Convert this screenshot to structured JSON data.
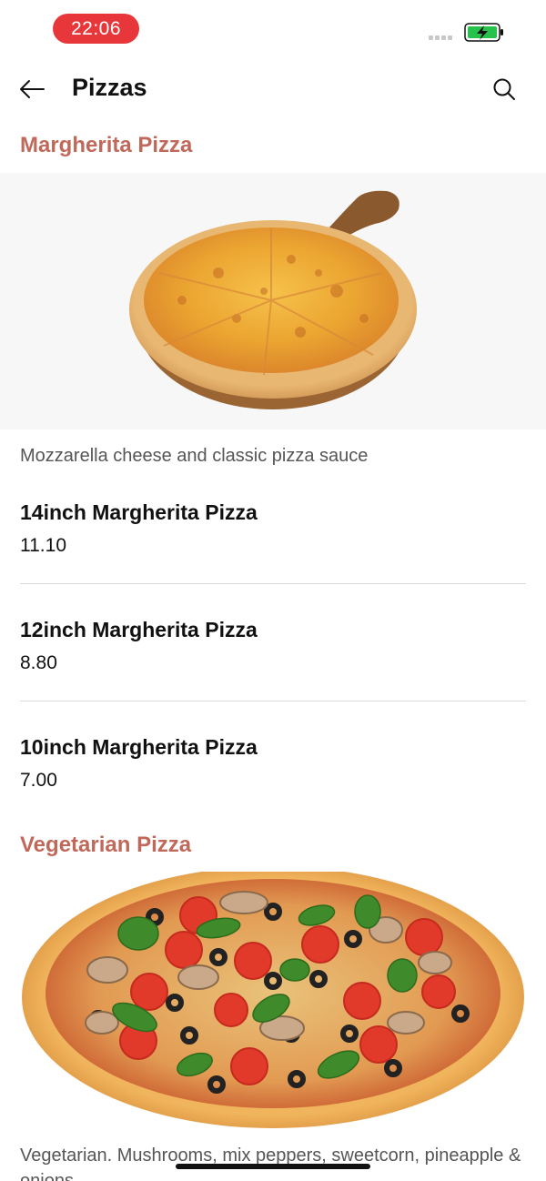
{
  "status_bar": {
    "time": "22:06",
    "battery_color": "#27c24c"
  },
  "nav": {
    "title": "Pizzas",
    "back_icon": "arrow-left-icon",
    "search_icon": "search-icon"
  },
  "categories": [
    {
      "title": "Margherita Pizza",
      "image": "margherita-pizza-photo",
      "description": "Mozzarella cheese and classic pizza sauce",
      "items": [
        {
          "name": "14inch Margherita Pizza",
          "price": "11.10"
        },
        {
          "name": "12inch Margherita Pizza",
          "price": "8.80"
        },
        {
          "name": "10inch Margherita Pizza",
          "price": "7.00"
        }
      ]
    },
    {
      "title": "Vegetarian Pizza",
      "image": "vegetarian-pizza-photo",
      "description": "Vegetarian. Mushrooms, mix peppers, sweetcorn, pineapple & onions"
    }
  ],
  "colors": {
    "accent": "#c0685a",
    "time_pill": "#e8373a"
  }
}
